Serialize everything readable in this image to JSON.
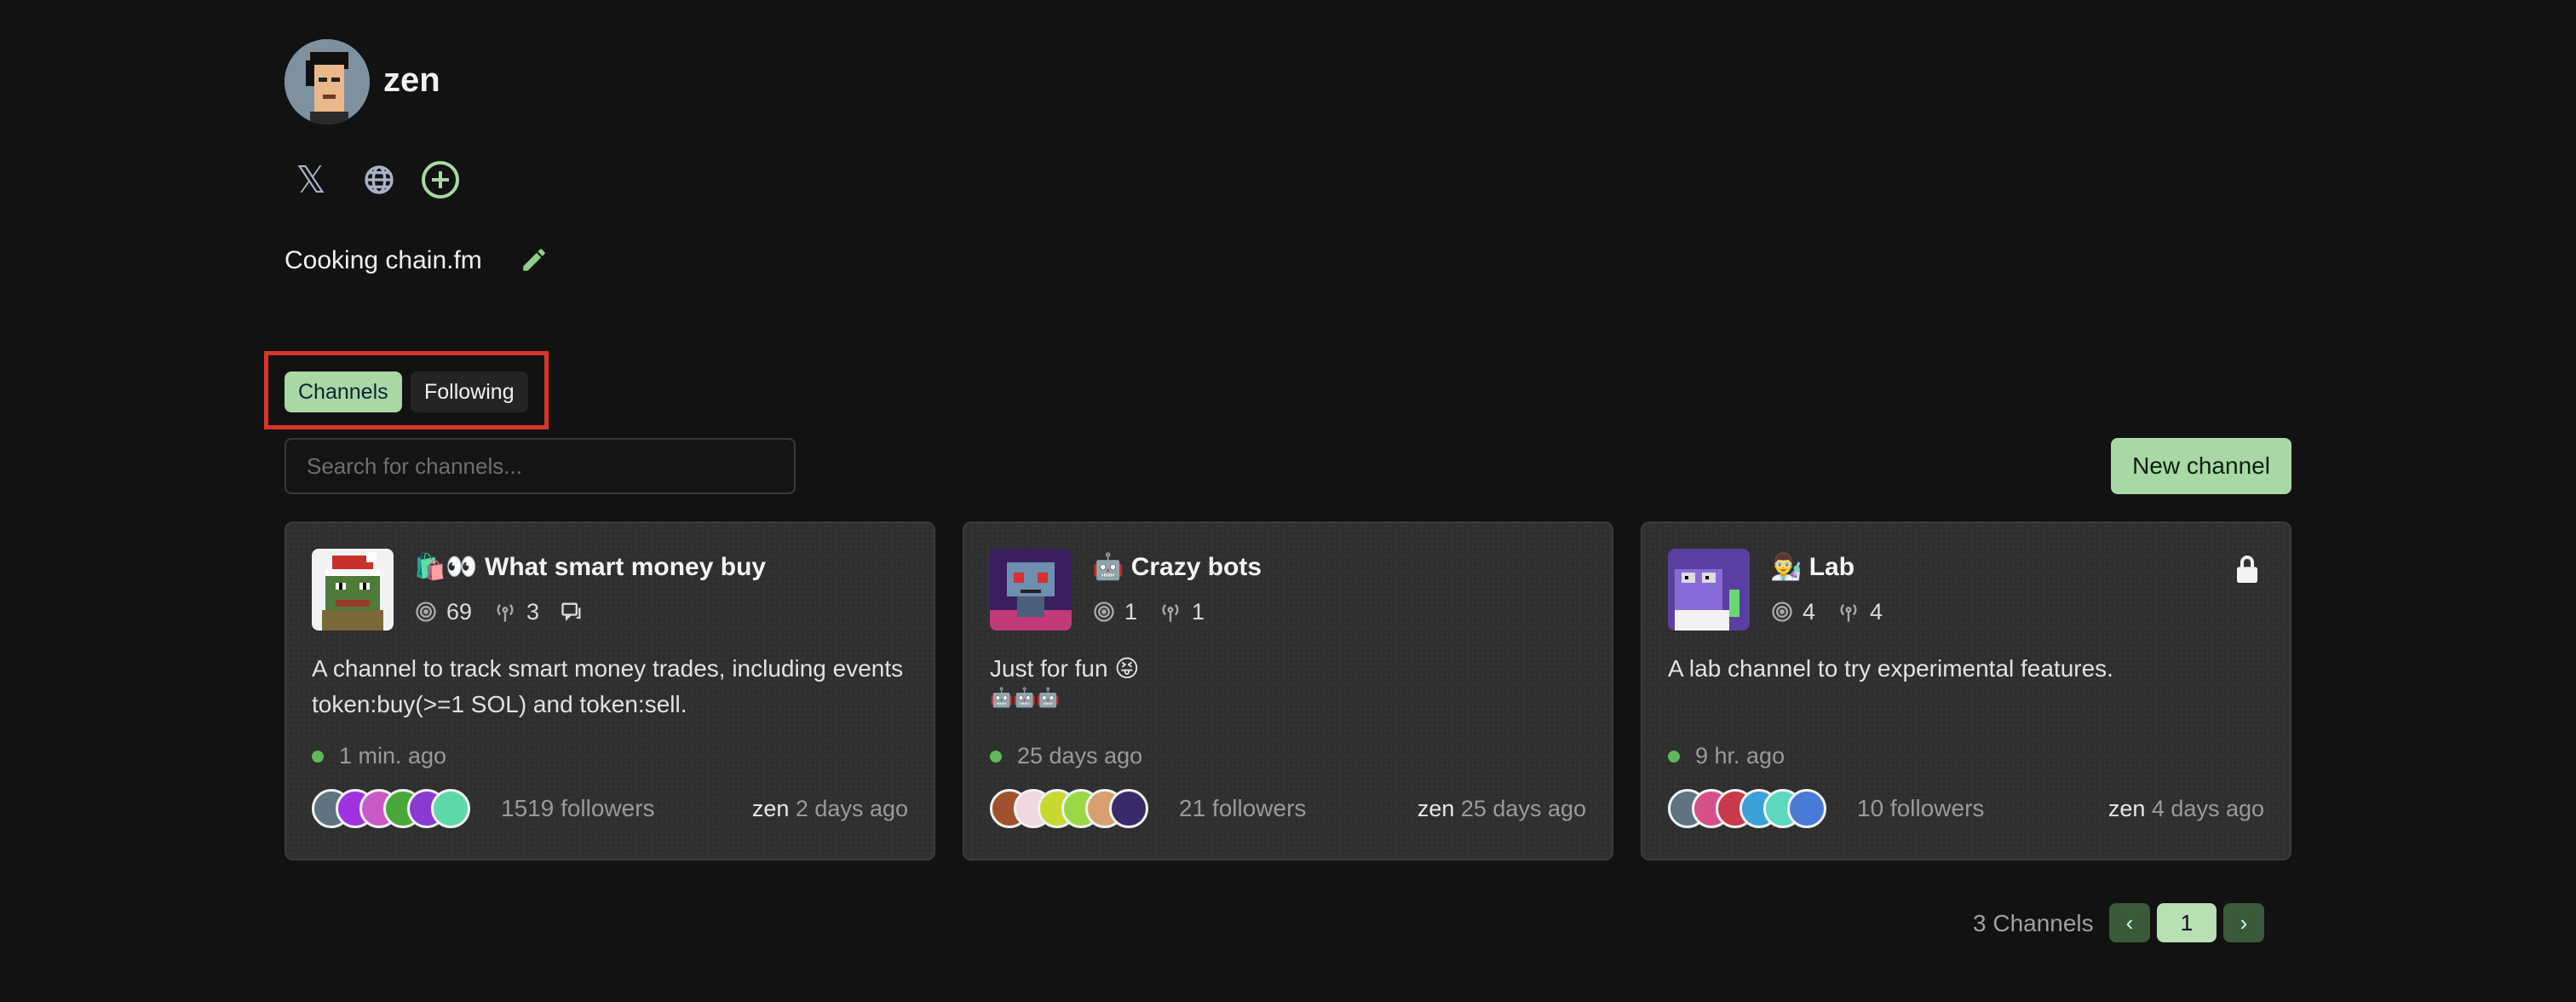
{
  "profile": {
    "username": "zen",
    "bio": "Cooking chain.fm",
    "social_icons": [
      "x-icon",
      "globe-icon",
      "plus-circle-icon"
    ]
  },
  "tabs": [
    {
      "label": "Channels",
      "active": true
    },
    {
      "label": "Following",
      "active": false
    }
  ],
  "search": {
    "placeholder": "Search for channels..."
  },
  "new_channel_label": "New channel",
  "channels": [
    {
      "title": "🛍️👀 What smart money buy",
      "targets": "69",
      "signals": "3",
      "has_chat": true,
      "description": "A channel to track smart money trades, including events token:buy(>=1 SOL) and token:sell.",
      "extra": "",
      "last_active": "1 min. ago",
      "followers": "1519 followers",
      "owner": "zen",
      "updated": "2 days ago",
      "locked": false
    },
    {
      "title": "🤖 Crazy bots",
      "targets": "1",
      "signals": "1",
      "has_chat": false,
      "description": "Just for fun 😝",
      "extra": "🤖🤖🤖",
      "last_active": "25 days ago",
      "followers": "21 followers",
      "owner": "zen",
      "updated": "25 days ago",
      "locked": false
    },
    {
      "title": "👨‍🔬 Lab",
      "targets": "4",
      "signals": "4",
      "has_chat": false,
      "description": "A lab channel to try experimental features.",
      "extra": "",
      "last_active": "9 hr. ago",
      "followers": "10 followers",
      "owner": "zen",
      "updated": "4 days ago",
      "locked": true
    }
  ],
  "pagination": {
    "label": "3 Channels",
    "current_page": "1",
    "prev": "‹",
    "next": "›"
  },
  "colors": {
    "accent": "#a8d8a4",
    "highlight_box": "#d9342b",
    "online": "#5fb85a"
  }
}
